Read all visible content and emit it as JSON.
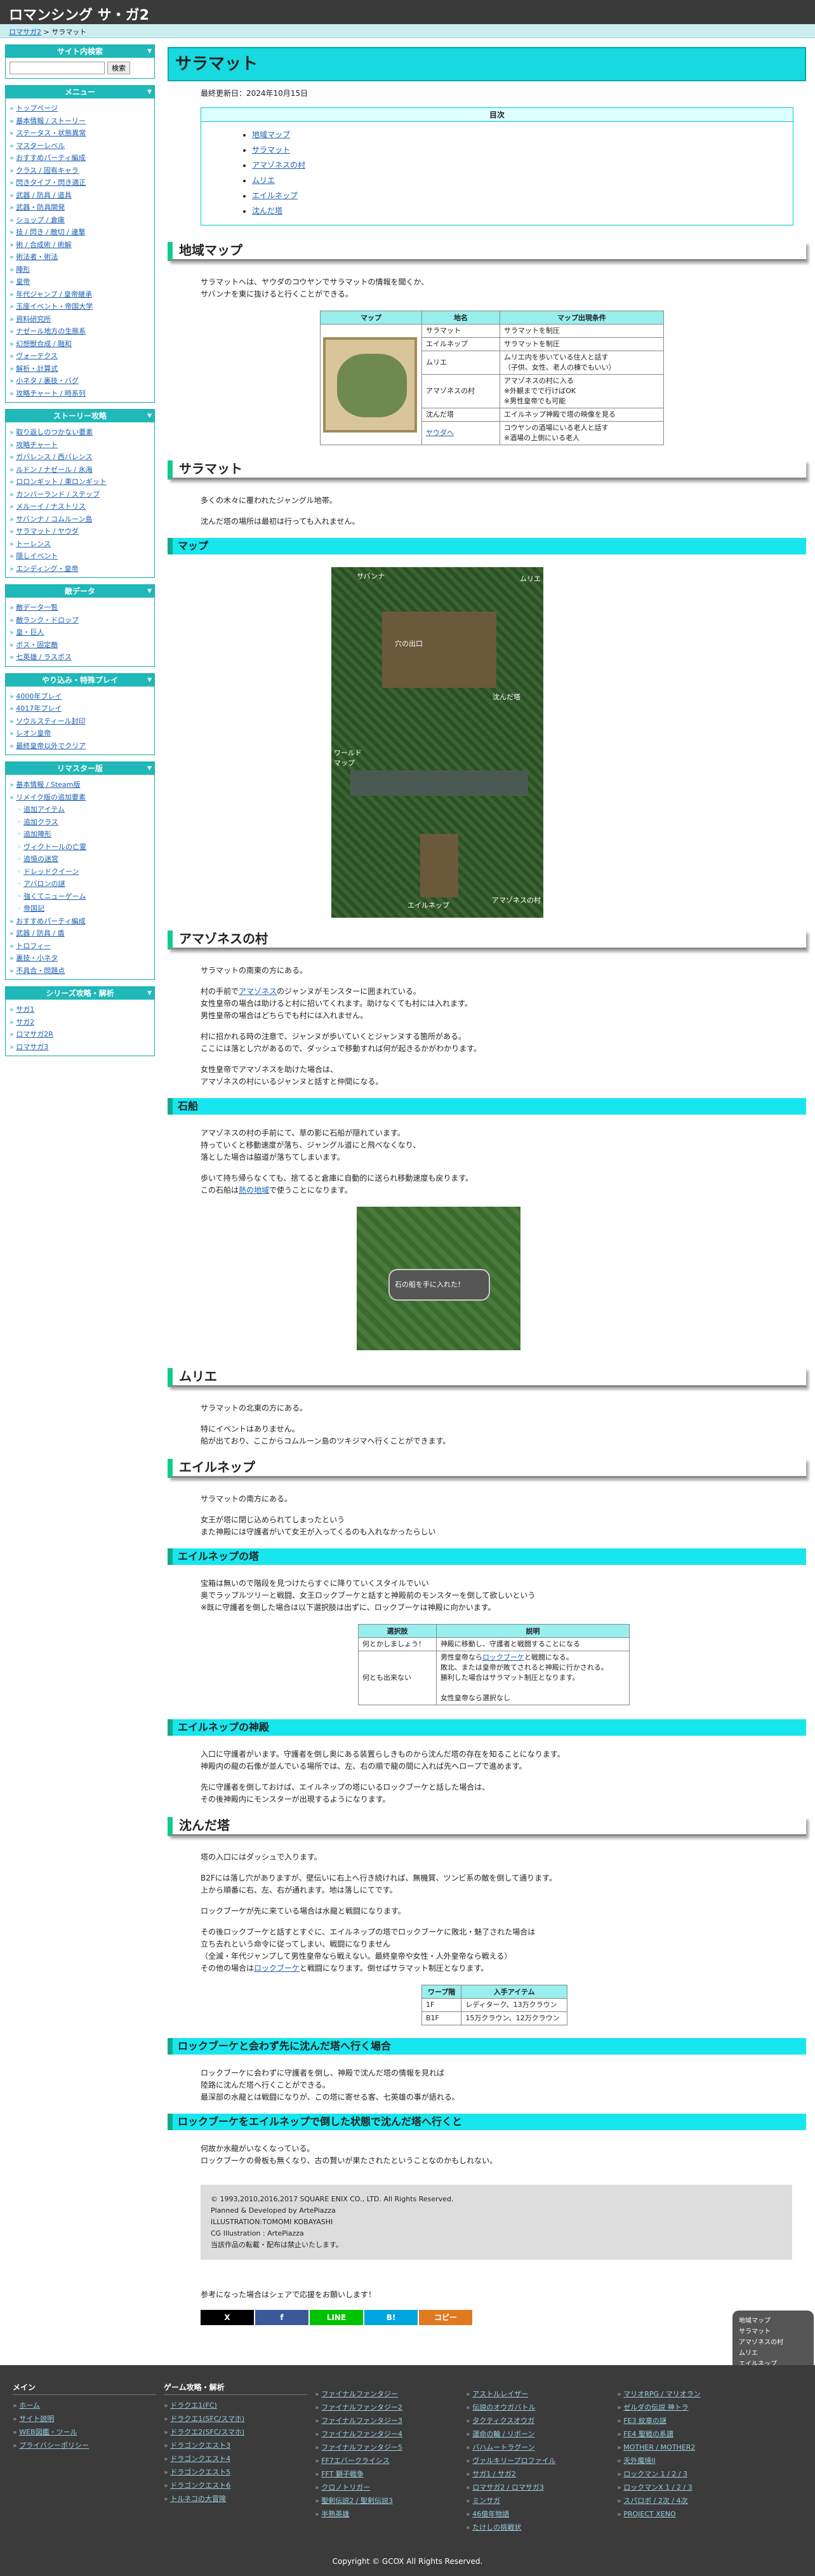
{
  "site_title": "ロマンシング サ・ガ2",
  "breadcrumb": {
    "home": "ロマサガ2",
    "sep": " > ",
    "current": "サラマット"
  },
  "sidebar": {
    "search": {
      "title": "サイト内検索",
      "button": "検索",
      "placeholder": ""
    },
    "menu": {
      "title": "メニュー",
      "items": [
        {
          "t": "トップページ"
        },
        {
          "t": "基本情報 / ストーリー"
        },
        {
          "t": "ステータス・状態異常"
        },
        {
          "t": "マスターレベル"
        },
        {
          "t": "おすすめパーティ編成"
        },
        {
          "t": "クラス / 固有キャラ"
        },
        {
          "t": "閃きタイプ・閃き適正"
        },
        {
          "t": "武器 / 防具 / 道具"
        },
        {
          "t": "武器・防具開発"
        },
        {
          "t": "ショップ / 倉庫"
        },
        {
          "t": "技 / 閃き / 敵切 / 連撃"
        },
        {
          "t": "術 / 合成術 / 術解"
        },
        {
          "t": "術法者・術法"
        },
        {
          "t": "陣形"
        },
        {
          "t": "皇帝"
        },
        {
          "t": "年代ジャンプ / 皇帝継承"
        },
        {
          "t": "玉座イベント・帝国大学"
        },
        {
          "t": "資料研究所"
        },
        {
          "t": "ナゼール地方の生態系"
        },
        {
          "t": "幻想獣合成 / 融和"
        },
        {
          "t": "ヴォーテクス"
        },
        {
          "t": "解析・計算式"
        },
        {
          "t": "小ネタ / 裏技・バグ"
        },
        {
          "t": "攻略チャート / 時系列"
        }
      ]
    },
    "guide": {
      "title": "ストーリー攻略",
      "items": [
        {
          "t": "取り返しのつかない要素"
        },
        {
          "t": "攻略チャート"
        },
        {
          "t": "ガバレンス / 西バレンス"
        },
        {
          "t": "ルドン / ナゼール / 氷海"
        },
        {
          "t": "ロロンギット / 東ロンギット"
        },
        {
          "t": "カンバーランド / ステップ"
        },
        {
          "t": "メルーイ / ナストリス"
        },
        {
          "t": "サバンナ / コムルーン島"
        },
        {
          "t": "サラマット / ヤウダ"
        },
        {
          "t": "トーレンス"
        },
        {
          "t": "隠しイベント"
        },
        {
          "t": "エンディング・皇帝"
        }
      ]
    },
    "data": {
      "title": "敵データ",
      "items": [
        {
          "t": "敵データ一覧"
        },
        {
          "t": "敵ランク・ドロップ"
        },
        {
          "t": "皇・巨人"
        },
        {
          "t": "ボス・固定敵"
        },
        {
          "t": "七英雄 / ラスボス"
        }
      ]
    },
    "play": {
      "title": "やり込み・特殊プレイ",
      "items": [
        {
          "t": "4000年プレイ"
        },
        {
          "t": "4017年プレイ"
        },
        {
          "t": "ソウルスティール封印"
        },
        {
          "t": "レオン皇帝"
        },
        {
          "t": "最終皇帝以外でクリア"
        }
      ]
    },
    "remaster": {
      "title": "リマスター版",
      "items": [
        {
          "t": "基本情報 / Steam版",
          "sub": false
        },
        {
          "t": "リメイク版の追加要素",
          "sub": false
        },
        {
          "t": "追加アイテム",
          "sub": true
        },
        {
          "t": "追加クラス",
          "sub": true
        },
        {
          "t": "追加陣形",
          "sub": true
        },
        {
          "t": "ヴィクトールの亡霊",
          "sub": true
        },
        {
          "t": "追憶の迷宮",
          "sub": true
        },
        {
          "t": "ドレッドクイーン",
          "sub": true
        },
        {
          "t": "アバロンの謎",
          "sub": true
        },
        {
          "t": "強くてニューゲーム",
          "sub": true
        },
        {
          "t": "帝国記",
          "sub": true
        },
        {
          "t": "おすすめパーティ編成",
          "sub": false
        },
        {
          "t": "武器 / 防具 / 盾",
          "sub": false
        },
        {
          "t": "トロフィー",
          "sub": false
        },
        {
          "t": "裏技・小ネタ",
          "sub": false
        },
        {
          "t": "不具合・問題点",
          "sub": false
        }
      ]
    },
    "series": {
      "title": "シリーズ攻略・解析",
      "items": [
        {
          "t": "サガ1"
        },
        {
          "t": "サガ2"
        },
        {
          "t": "ロマサガ2R"
        },
        {
          "t": "ロマサガ3"
        }
      ]
    }
  },
  "main": {
    "title": "サラマット",
    "updated": "最終更新日：2024年10月15日",
    "toc": {
      "title": "目次",
      "items": [
        "地域マップ",
        "サラマット",
        "アマゾネスの村",
        "ムリエ",
        "エイルネップ",
        "沈んだ塔"
      ]
    },
    "s_map": {
      "h": "地域マップ",
      "p1": "サラマットへは、ヤウダのコウヤンでサラマットの情報を聞くか、",
      "p2": "サバンナを東に抜けると行くことができる。",
      "th": [
        "マップ",
        "地名",
        "マップ出現条件"
      ],
      "rows": [
        [
          "サラマット",
          "サラマットを制圧"
        ],
        [
          "エイルネップ",
          "サラマットを制圧"
        ],
        [
          "ムリエ",
          "ムリエ内を歩いている住人と話す\n（子供、女性、老人の棟でもいい）"
        ],
        [
          "アマゾネスの村",
          "アマゾネスの村に入る\n※外観までで行けばOK\n※男性皇帝でも可能"
        ],
        [
          "沈んだ塔",
          "エイルネップ神殿で塔の映像を見る"
        ],
        [
          "ヤウダへ",
          "コウヤンの酒場にいる老人と話す\n※酒場の上側にいる老人"
        ]
      ]
    },
    "s_sal": {
      "h": "サラマット",
      "p1": "多くの木々に覆われたジャングル地帯。",
      "p2": "沈んだ塔の場所は最初は行っても入れません。",
      "map_h": "マップ",
      "labels": {
        "tl": "サバンナ",
        "tr": "ムリエ",
        "cave": "穴の出口",
        "tower": "沈んだ塔",
        "wm": "ワールド\nマップ",
        "eil": "エイルネップ",
        "ama": "アマゾネスの村"
      }
    },
    "s_ama": {
      "h": "アマゾネスの村",
      "p1": "サラマットの南東の方にある。",
      "p2": "村の手前で",
      "link": "アマゾネス",
      "p2b": "のジャンヌがモンスターに囲まれている。",
      "p3": "女性皇帝の場合は助けると村に招いてくれます。助けなくても村には入れます。",
      "p4": "男性皇帝の場合はどちらでも村には入れません。",
      "p5": "村に招かれる時の注意で、ジャンヌが歩いていくとジャンヌする箇所がある。",
      "p6": "ここには落とし穴があるので、ダッシュで移動すれば何が起きるかがわかります。",
      "p7": "女性皇帝でアマゾネスを助けた場合は、",
      "p8": "アマゾネスの村にいるジャンヌと話すと仲間になる。",
      "stone_h": "石船",
      "s1": "アマゾネスの村の手前にて、草の影に石船が隠れています。",
      "s2": "持っていくと移動速度が落ち、ジャングル道にと飛べなくなり、",
      "s3": "落とした場合は脇道が落ちてしまいます。",
      "s4": "歩いて持ち帰らなくても、捨てると倉庫に自動的に送られ移動速度も戻ります。",
      "s5": "この石船は",
      "link2": "熱の地域",
      "s5b": "で使うことになります。",
      "caption": "石の船を手に入れた！"
    },
    "s_mur": {
      "h": "ムリエ",
      "p1": "サラマットの北東の方にある。",
      "p2": "特にイベントはありません。",
      "p3": "船が出ており、ここからコムルーン島のツキジマへ行くことができます。"
    },
    "s_eil": {
      "h": "エイルネップ",
      "p1": "サラマットの南方にある。",
      "p2": "女王が塔に閉じ込められてしまったという",
      "p3": "また神殿には守護者がいて女王が入ってくるのも入れなかったらしい",
      "tower_h": "エイルネップの塔",
      "t1": "宝箱は無いので階段を見つけたらすぐに降りていくスタイルでいい",
      "t2": "奥でラップルツリーと戦闘、女王ロックブーケと話すと神殿前のモンスターを倒して欲しいという",
      "t3": "※既に守護者を倒した場合は以下選択肢は出ずに、ロックブーケは神殿に向かいます。",
      "sel_th": [
        "選択肢",
        "説明"
      ],
      "sel1": "何とかしましょう！",
      "sel1d": "神殿に移動し、守護者と戦闘することになる",
      "sel2": "何とも出来ない",
      "sel2d1": "男性皇帝なら",
      "sel2link": "ロックブーケ",
      "sel2d2": "と戦闘になる。",
      "sel2d3": "敗北、または皇帝が敗てされると神殿に行かされる。",
      "sel2d4": "勝利した場合はサラマット制圧となります。",
      "sel2d5": "女性皇帝なら選択なし",
      "shrine_h": "エイルネップの神殿",
      "sh1": "入口に守護者がいます。守護者を倒し奥にある装置らしきものから沈んだ塔の存在を知ることになります。",
      "sh2": "神殿内の龍の石像が並んでいる場所では、左、右の順で龍の間に入れば先へロープで進めます。",
      "sh3": "先に守護者を倒しておけば、エイルネップの塔にいるロックブーケと話した場合は、",
      "sh4": "その後神殿内にモンスターが出現するようになります。"
    },
    "s_tow": {
      "h": "沈んだ塔",
      "p1": "塔の入口にはダッシュで入ります。",
      "p2": "B2Fには落し穴がありますが、壁伝いに右上へ行き続ければ、無機質、ツンビ系の敵を倒して通ります。",
      "p3": "上から順番に右、左、右が通れます。地は落しにてです。",
      "p4": "ロックブーケが先に来ている場合は水龍と戦闘になります。",
      "p5": "その後ロックブーケと話すとすぐに、エイルネップの塔でロックブーケに敗北・魅了された場合は",
      "p6": "立ち去れという命令に従ってしまい、戦闘になりません",
      "p7": "（全滅・年代ジャンプして男性皇帝なら戦えない。最終皇帝や女性・人外皇帝なら戦える）",
      "p8": "その他の場合は",
      "link": "ロックブーケ",
      "p8b": "と戦闘になります。倒せばサラマット制圧となります。",
      "itm_th": [
        "ワープ階",
        "入手アイテム"
      ],
      "itm": [
        [
          "1F",
          "レディターク、13万クラウン"
        ],
        [
          "B1F",
          "15万クラウン、12万クラウン"
        ]
      ],
      "h_a": "ロックブーケと会わず先に沈んだ塔へ行く場合",
      "a1": "ロックブーケに会わずに守護者を倒し、神殿で沈んだ塔の情報を見れば",
      "a2": "陸路に沈んだ塔へ行くことができる。",
      "a3": "最深部の水龍とは戦闘になりが、この塔に寄せる客、七英雄の事が語れる。",
      "h_b": "ロックブーケをエイルネップで倒した状態で沈んだ塔へ行くと",
      "b1": "何故か水龍がいなくなっている。",
      "b2": "ロックブーケの骨板も無くなり、古の賢いが果たされたということなのかもしれない。"
    },
    "copyright": [
      "© 1993,2010,2016,2017 SQUARE ENIX CO., LTD. All Rights Reserved.",
      "Planned & Developed by ArtePiazza",
      "ILLUSTRATION:TOMOMI KOBAYASHI",
      "CG Illustration : ArtePiazza",
      "当該作品の転載・配布は禁止いたします。"
    ],
    "share": {
      "text": "参考になった場合はシェアで応援をお願いします！",
      "buttons": [
        {
          "t": "X",
          "c": "#000000"
        },
        {
          "t": "f",
          "c": "#3b5998"
        },
        {
          "t": "LINE",
          "c": "#00c300"
        },
        {
          "t": "B!",
          "c": "#00a4de"
        },
        {
          "t": "コピー",
          "c": "#e07a20"
        }
      ]
    }
  },
  "float_nav": [
    "地域マップ",
    "サラマット",
    "アマゾネスの村",
    "ムリエ",
    "エイルネップ",
    "沈んだ塔",
    "Home",
    "Back to Top",
    "Back"
  ],
  "footer": {
    "c1": {
      "h": "メイン",
      "items": [
        "ホーム",
        "サイト説明",
        "WEB図鑑・ツール",
        "プライバシーポリシー"
      ]
    },
    "c2": {
      "h": "ゲーム攻略・解析",
      "items": [
        "ドラクエ1(FC)",
        "ドラクエ1(SFC/スマホ)",
        "ドラクエ2(SFC/スマホ)",
        "ドラゴンクエスト3",
        "ドラゴンクエスト4",
        "ドラゴンクエスト5",
        "ドラゴンクエスト6",
        "トルネコの大冒険"
      ]
    },
    "c3": {
      "h": "",
      "items": [
        "ファイナルファンタジー",
        "ファイナルファンタジー2",
        "ファイナルファンタジー3",
        "ファイナルファンタジー4",
        "ファイナルファンタジー5",
        "FF7エバークライシス",
        "FFT 獅子戦争",
        "クロノトリガー",
        "聖剣伝説2 / 聖剣伝説3",
        "半熟英雄"
      ]
    },
    "c4": {
      "h": "",
      "items": [
        "アストルレイザー",
        "伝説のオウガバトル",
        "タクティクスオウガ",
        "運命の輪 / リボーン",
        "バハムートラグーン",
        "ヴァルキリープロファイル",
        "サガ1 / サガ2",
        "ロマサガ2 / ロマサガ3",
        "ミンサガ",
        "46億年物語",
        "たけしの挑戦状"
      ]
    },
    "c5": {
      "h": "",
      "items": [
        "マリオRPG / マリオラン",
        "ゼルダの伝説 神トラ",
        "FE3 紋章の謎",
        "FE4 聖戦の系譜",
        "MOTHER / MOTHER2",
        "天外魔境II",
        "ロックマン 1 / 2 / 3",
        "ロックマンX 1 / 2 / 3",
        "スパロボ / 2次 / 4次",
        "PROJECT XENO"
      ]
    },
    "copyright": "Copyright © GCOX All Rights Reserved."
  },
  "colors": {
    "accent": "#18d8e0",
    "sidebar_head": "#20b8b8",
    "footer_bg": "#3b3b3b"
  }
}
